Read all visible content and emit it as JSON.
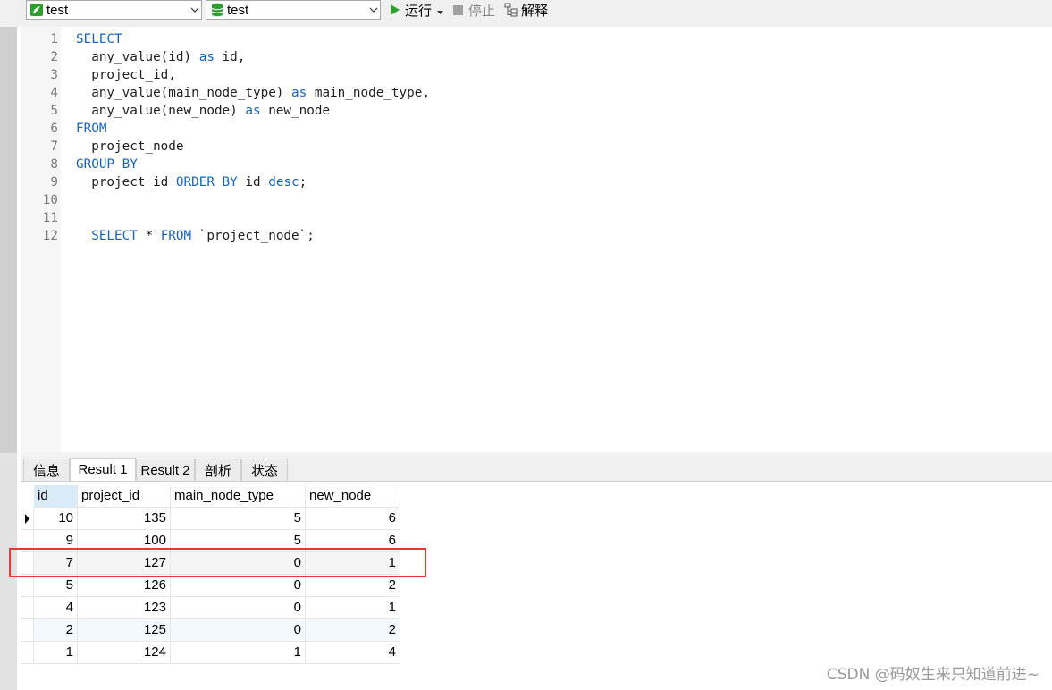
{
  "toolbar": {
    "connection": "test",
    "database": "test",
    "run_label": "运行",
    "stop_label": "停止",
    "explain_label": "解释"
  },
  "editor": {
    "lines": [
      {
        "num": "1",
        "indent": "",
        "tokens": [
          {
            "t": "SELECT",
            "kw": true
          }
        ]
      },
      {
        "num": "2",
        "indent": "  ",
        "tokens": [
          {
            "t": "any_value(id) ",
            "kw": false
          },
          {
            "t": "as",
            "kw": true
          },
          {
            "t": " id,",
            "kw": false
          }
        ]
      },
      {
        "num": "3",
        "indent": "  ",
        "tokens": [
          {
            "t": "project_id,",
            "kw": false
          }
        ]
      },
      {
        "num": "4",
        "indent": "  ",
        "tokens": [
          {
            "t": "any_value(main_node_type) ",
            "kw": false
          },
          {
            "t": "as",
            "kw": true
          },
          {
            "t": " main_node_type,",
            "kw": false
          }
        ]
      },
      {
        "num": "5",
        "indent": "  ",
        "tokens": [
          {
            "t": "any_value(new_node) ",
            "kw": false
          },
          {
            "t": "as",
            "kw": true
          },
          {
            "t": " new_node",
            "kw": false
          }
        ]
      },
      {
        "num": "6",
        "indent": "",
        "tokens": [
          {
            "t": "FROM",
            "kw": true
          }
        ]
      },
      {
        "num": "7",
        "indent": "  ",
        "tokens": [
          {
            "t": "project_node",
            "kw": false
          }
        ]
      },
      {
        "num": "8",
        "indent": "",
        "tokens": [
          {
            "t": "GROUP BY",
            "kw": true
          }
        ]
      },
      {
        "num": "9",
        "indent": "  ",
        "tokens": [
          {
            "t": "project_id ",
            "kw": false
          },
          {
            "t": "ORDER BY",
            "kw": true
          },
          {
            "t": " id ",
            "kw": false
          },
          {
            "t": "desc",
            "kw": true
          },
          {
            "t": ";",
            "kw": false
          }
        ]
      },
      {
        "num": "10",
        "indent": "",
        "tokens": []
      },
      {
        "num": "11",
        "indent": "",
        "tokens": []
      },
      {
        "num": "12",
        "indent": "  ",
        "tokens": [
          {
            "t": "SELECT",
            "kw": true
          },
          {
            "t": " * ",
            "kw": false
          },
          {
            "t": "FROM",
            "kw": true
          },
          {
            "t": " `project_node`;",
            "kw": false
          }
        ]
      }
    ]
  },
  "tabs": [
    {
      "label": "信息",
      "active": false
    },
    {
      "label": "Result 1",
      "active": true
    },
    {
      "label": "Result 2",
      "active": false
    },
    {
      "label": "剖析",
      "active": false
    },
    {
      "label": "状态",
      "active": false
    }
  ],
  "grid": {
    "columns": [
      "id",
      "project_id",
      "main_node_type",
      "new_node"
    ],
    "rows": [
      [
        "10",
        "135",
        "5",
        "6"
      ],
      [
        "9",
        "100",
        "5",
        "6"
      ],
      [
        "7",
        "127",
        "0",
        "1"
      ],
      [
        "5",
        "126",
        "0",
        "2"
      ],
      [
        "4",
        "123",
        "0",
        "1"
      ],
      [
        "2",
        "125",
        "0",
        "2"
      ],
      [
        "1",
        "124",
        "1",
        "4"
      ]
    ],
    "current_row": 0,
    "highlighted_row": 2
  },
  "colors": {
    "keyword": "#1565c0",
    "run_icon": "#2e9e2e",
    "highlight": "#e53935",
    "header_selected": "#d9ebf9"
  },
  "watermark": "CSDN @码奴生来只知道前进~"
}
